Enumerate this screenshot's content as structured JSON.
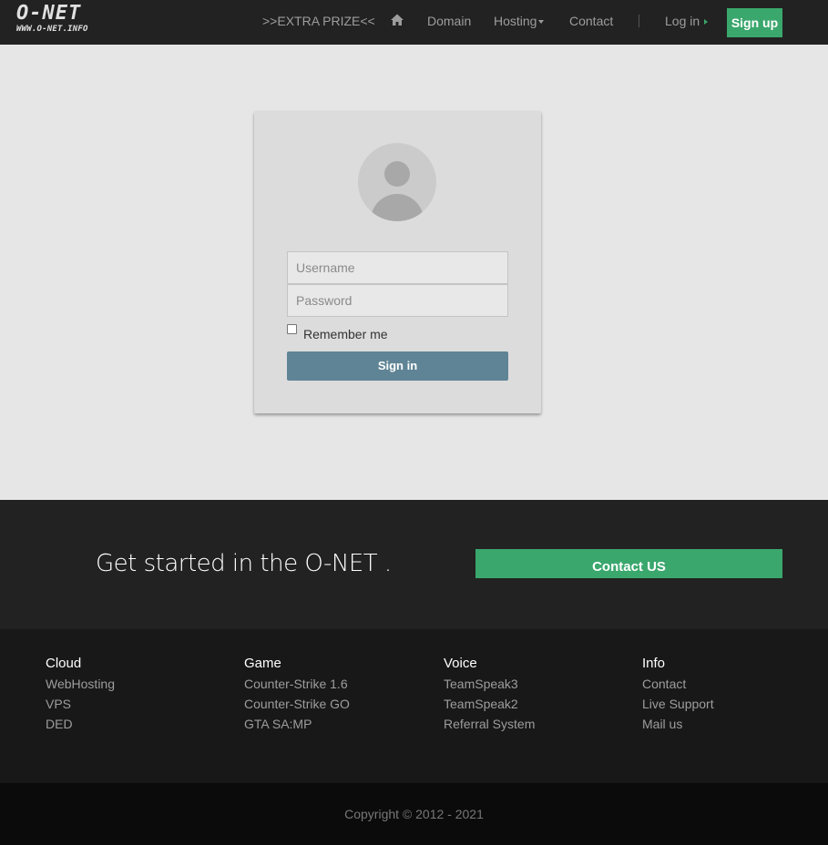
{
  "navbar": {
    "logo_main": "O-NET",
    "logo_sub": "WWW.O-NET.INFO",
    "extra_prize": ">>EXTRA PRIZE<<",
    "home_icon": "home-icon",
    "domain": "Domain",
    "hosting": "Hosting",
    "contact": "Contact",
    "login": "Log in",
    "signup": "Sign up"
  },
  "login": {
    "avatar_icon": "user-avatar-icon",
    "username_placeholder": "Username",
    "password_placeholder": "Password",
    "remember_label": "Remember me",
    "signin_label": "Sign in"
  },
  "cta": {
    "text": "Get started in the O-NET .",
    "button": "Contact US"
  },
  "footer": {
    "columns": [
      {
        "title": "Cloud",
        "links": [
          "WebHosting",
          "VPS",
          "DED"
        ]
      },
      {
        "title": "Game",
        "links": [
          "Counter-Strike 1.6",
          "Counter-Strike GO",
          "GTA SA:MP"
        ]
      },
      {
        "title": "Voice",
        "links": [
          "TeamSpeak3",
          "TeamSpeak2",
          "Referral System"
        ]
      },
      {
        "title": "Info",
        "links": [
          "Contact",
          "Live Support",
          "Mail us"
        ]
      }
    ],
    "copyright": "Copyright © 2012 - 2021"
  },
  "colors": {
    "navbar_bg": "#222222",
    "accent_green": "#3aa76d",
    "signin_blue": "#5f8495",
    "page_bg": "#e6e6e6"
  }
}
